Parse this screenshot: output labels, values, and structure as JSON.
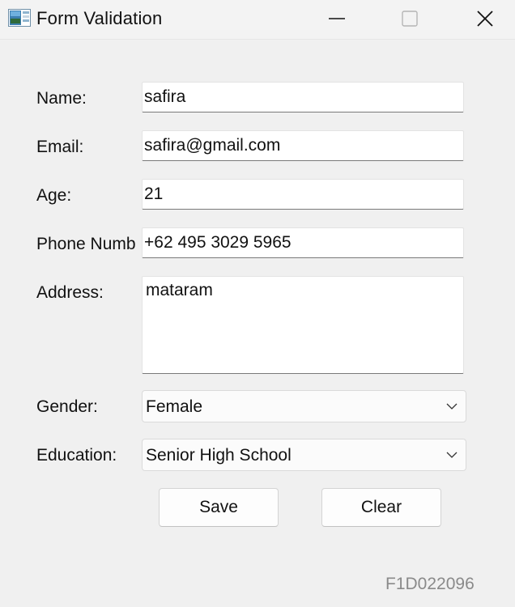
{
  "window": {
    "title": "Form Validation",
    "minimize_icon": "minimize-icon",
    "maximize_icon": "maximize-icon",
    "close_icon": "close-icon"
  },
  "form": {
    "name": {
      "label": "Name:",
      "value": "safira"
    },
    "email": {
      "label": "Email:",
      "value": "safira@gmail.com"
    },
    "age": {
      "label": "Age:",
      "value": "21"
    },
    "phone": {
      "label": "Phone Numb",
      "value": "+62 495 3029 5965"
    },
    "address": {
      "label": "Address:",
      "value": "mataram"
    },
    "gender": {
      "label": "Gender:",
      "value": "Female"
    },
    "education": {
      "label": "Education:",
      "value": "Senior High School"
    }
  },
  "buttons": {
    "save": "Save",
    "clear": "Clear"
  },
  "footer": {
    "student_id": "F1D022096"
  }
}
